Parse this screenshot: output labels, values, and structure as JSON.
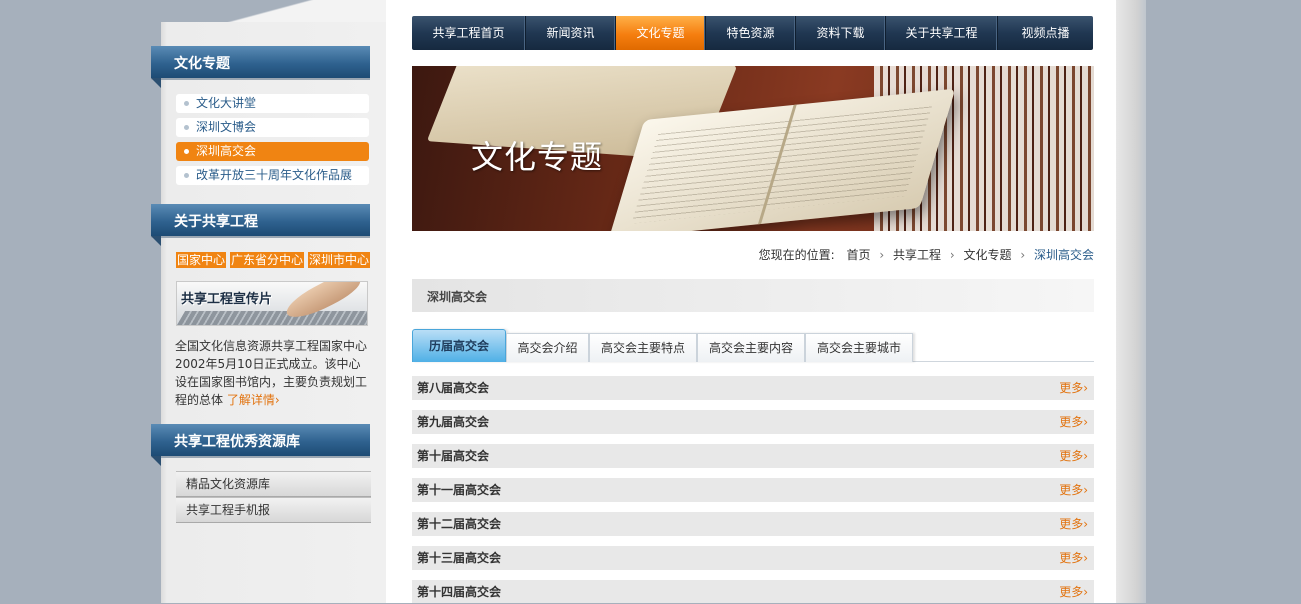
{
  "nav": {
    "items": [
      {
        "label": "共享工程首页",
        "active": false
      },
      {
        "label": "新闻资讯",
        "active": false
      },
      {
        "label": "文化专题",
        "active": true
      },
      {
        "label": "特色资源",
        "active": false
      },
      {
        "label": "资料下载",
        "active": false
      },
      {
        "label": "关于共享工程",
        "active": false
      },
      {
        "label": "视频点播",
        "active": false
      }
    ]
  },
  "sidebar": {
    "topics_title": "文化专题",
    "topics": [
      {
        "label": "文化大讲堂",
        "active": false
      },
      {
        "label": "深圳文博会",
        "active": false
      },
      {
        "label": "深圳高交会",
        "active": true
      },
      {
        "label": "改革开放三十周年文化作品展",
        "active": false
      }
    ],
    "about_title": "关于共享工程",
    "centers": [
      "国家中心",
      "广东省分中心",
      "深圳市中心"
    ],
    "promo_label": "共享工程宣传片",
    "intro_text": "全国文化信息资源共享工程国家中心2002年5月10日正式成立。该中心设在国家图书馆内，主要负责规划工程的总体",
    "intro_more": "了解详情›",
    "resources_title": "共享工程优秀资源库",
    "resources": [
      "精品文化资源库",
      "共享工程手机报"
    ]
  },
  "banner": {
    "title": "文化专题"
  },
  "breadcrumb": {
    "prefix": "您现在的位置:",
    "items": [
      "首页",
      "共享工程",
      "文化专题",
      "深圳高交会"
    ],
    "separator": "›"
  },
  "section": {
    "title": "深圳高交会"
  },
  "tabs": [
    {
      "label": "历届高交会",
      "active": true
    },
    {
      "label": "高交会介绍",
      "active": false
    },
    {
      "label": "高交会主要特点",
      "active": false
    },
    {
      "label": "高交会主要内容",
      "active": false
    },
    {
      "label": "高交会主要城市",
      "active": false
    }
  ],
  "list": {
    "more_label": "更多›",
    "rows": [
      "第八届高交会",
      "第九届高交会",
      "第十届高交会",
      "第十一届高交会",
      "第十二届高交会",
      "第十三届高交会",
      "第十四届高交会"
    ]
  },
  "colors": {
    "accent": "#f08412",
    "nav": "#203752",
    "tab_active": "#4fb0e6"
  }
}
